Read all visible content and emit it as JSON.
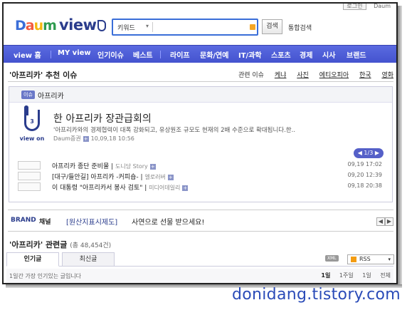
{
  "header": {
    "login_label": "로그인",
    "daum_label": "Daum",
    "logo_daum": [
      "D",
      "a",
      "u",
      "m"
    ],
    "logo_view": "view",
    "search_scope": "키워드",
    "search_value": "",
    "search_button": "검색",
    "total_search": "통합검색"
  },
  "nav": {
    "items": [
      "view 홈",
      "MY view",
      "인기이슈",
      "베스트",
      "라이프",
      "문화/연예",
      "IT/과학",
      "스포츠",
      "경제",
      "시사",
      "브랜드"
    ]
  },
  "recommend": {
    "title": "'아프리카' 추천 이슈",
    "tabs_label": "관련 이슈",
    "tabs": [
      "케냐",
      "사진",
      "에티오피아",
      "한국",
      "영화"
    ]
  },
  "issue": {
    "badge": "이슈",
    "name": "아프리카",
    "view_count": "3",
    "view_label": "view on",
    "headline": "한 아프리카 장관급회의",
    "summary": "'아프리카와의 경제협력이 대폭 강화되고, 유상원조 규모도 현재의 2배 수준으로 확대됩니다.한..",
    "source": "Daum증권",
    "date": "10,09,18 10:56",
    "pager": "◀ 1/3 ▶",
    "related": [
      {
        "title": "아프리카 종단 준비물",
        "source": "도니당 Story",
        "date": "09,19 17:02"
      },
      {
        "title": "[대구/들안길] 아프리카 -커피숍-",
        "source": "엘로러버",
        "date": "09,20 12:39"
      },
      {
        "title": "이 대통령 \"아프리카서 봉사 검토\"",
        "source": "미디어데일리",
        "date": "09,18 20:38"
      }
    ]
  },
  "brand": {
    "label_brand": "BRAND",
    "label_channel": "채널",
    "campaign": "[원산지표시제도]",
    "message": "사연으로 선물 받으세요!",
    "prev": "◀",
    "next": "▶"
  },
  "related_posts": {
    "title": "'아프리카' 관련글",
    "count": "(총 48,454건)",
    "tabs": [
      "인기글",
      "최신글"
    ],
    "xml_label": "XML",
    "rss_label": "RSS",
    "hint": "1일간 가장 인기있는 글입니다",
    "periods": [
      "1일",
      "1주일",
      "1일",
      "전체"
    ]
  },
  "watermark": "donidang.tistory.com"
}
